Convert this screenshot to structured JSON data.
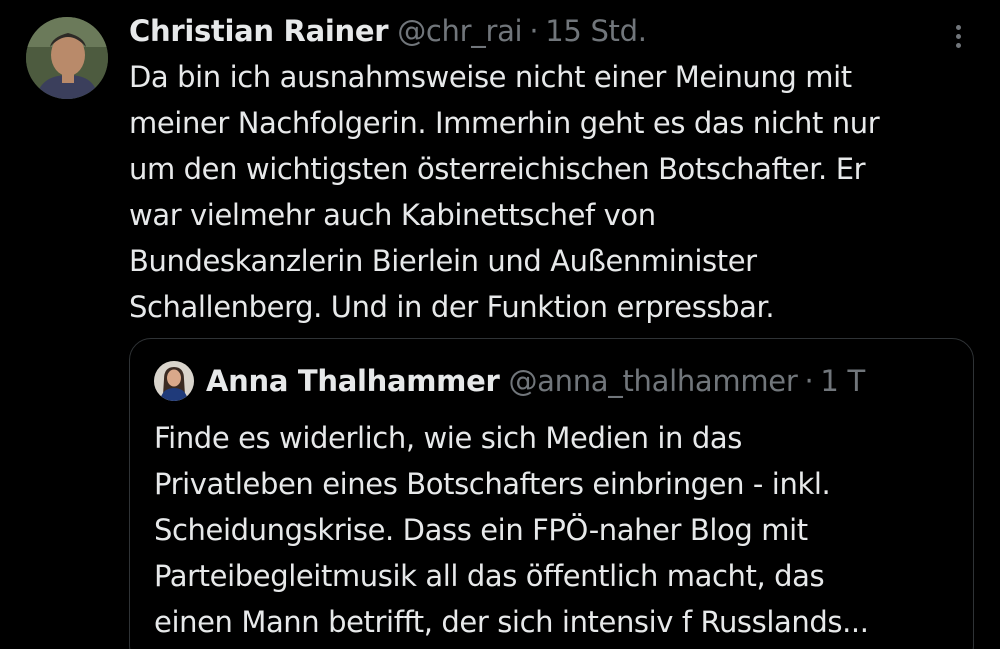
{
  "tweet": {
    "author_name": "Christian Rainer",
    "author_handle": "@chr_rai",
    "separator": "·",
    "timestamp": "15 Std.",
    "text": "Da bin ich ausnahmsweise nicht einer Meinung mit\nmeiner Nachfolgerin. Immerhin geht es das nicht nur\num den wichtigsten österreichischen Botschafter. Er\nwar vielmehr auch Kabinettschef von\nBundeskanzlerin Bierlein und Außenminister\nSchallenberg. Und in der Funktion erpressbar."
  },
  "quoted_tweet": {
    "author_name": "Anna Thalhammer",
    "author_handle": "@anna_thalhammer",
    "separator": "·",
    "timestamp": "1 T",
    "text": "Finde es widerlich, wie sich Medien in das\nPrivatleben eines Botschafters einbringen - inkl.\nScheidungskrise. Dass ein FPÖ-naher Blog mit\nParteibegleitmusik all das öffentlich macht, das\neinen Mann betrifft, der sich intensiv f Russlands..."
  },
  "icons": {
    "more": "more-vertical-icon"
  },
  "colors": {
    "background": "#000000",
    "text_primary": "#e7e9ea",
    "text_secondary": "#71767b",
    "border": "#2f3336"
  }
}
